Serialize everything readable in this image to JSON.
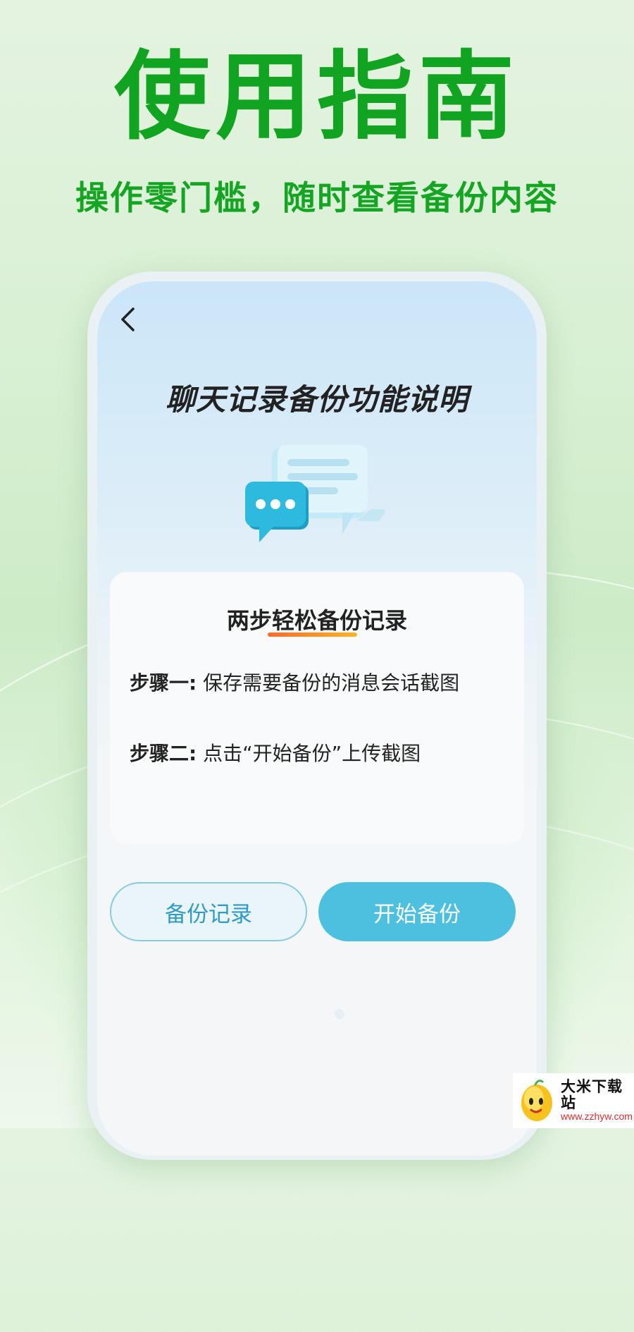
{
  "hero": {
    "title": "使用指南",
    "subtitle": "操作零门槛，随时查看备份内容"
  },
  "screen": {
    "title": "聊天记录备份功能说明",
    "back_icon": "chevron-left-icon",
    "illustration_icon": "chat-bubbles-icon"
  },
  "steps_card": {
    "heading": "两步轻松备份记录",
    "steps": [
      {
        "label": "步骤一:",
        "text": " 保存需要备份的消息会话截图"
      },
      {
        "label": "步骤二:",
        "text": " 点击“开始备份”上传截图"
      }
    ]
  },
  "buttons": {
    "records_label": "备份记录",
    "start_label": "开始备份"
  },
  "watermark": {
    "name": "大米下载站",
    "url": "www.zzhyw.com"
  },
  "colors": {
    "hero_green": "#11a420",
    "accent_blue": "#4ec0df",
    "underline_start": "#ff6a2a",
    "underline_end": "#ffb21f"
  }
}
